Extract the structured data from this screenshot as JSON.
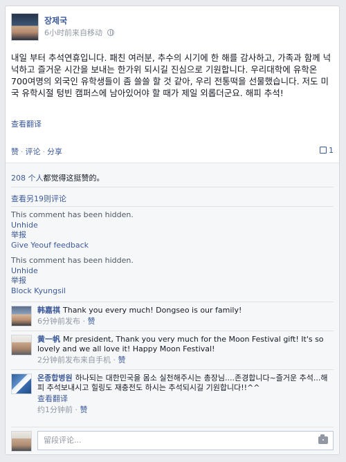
{
  "post": {
    "author": "장제국",
    "meta_time": "6小时前来自移动",
    "text": "내일 부터 추석연휴입니다. 패친 여러분, 추수의 시기에 한 해를 감사하고, 가족과 함께 넉넉하고 즐거운 시간을 보내는 한가위 되시길 진심으로 기원합니다. 우리대학에 유학온 700여명의 외국인 유학생들이 좀 쓸쓸 할 것 같아, 우리 전통떡을 선물했습니다. 저도 미국 유학시절 텅빈 캠퍼스에 남아있어야 할 때가 제일 외롭더군요. 해피 추석!",
    "see_translation": "查看翻译"
  },
  "actions": {
    "like": "赞",
    "comment": "评论",
    "share": "分享",
    "separator": "·",
    "comment_count": "1"
  },
  "ufi": {
    "likes_link": "208 个人",
    "likes_rest": "都觉得这挺赞的。",
    "view_more": "查看另19则评论",
    "hidden1": {
      "text": "This comment has been hidden.",
      "unhide": "Unhide",
      "report": "举报",
      "feedback": "Give Yeouf feedback"
    },
    "hidden2": {
      "text": "This comment has been hidden.",
      "unhide": "Unhide",
      "report": "举报",
      "block": "Block Kyungsil"
    }
  },
  "comments": [
    {
      "name": "韩嘉祺",
      "text": "Thank you every much! Dongseo is our family!",
      "time": "6分钟前发布",
      "like": "赞"
    },
    {
      "name": "黄一帆",
      "text": "Mr president, Thank you very much for the Moon Festival gift! It's so lovely and we all love it! Happy Moon Festival!",
      "time": "2分钟前发布来自手机",
      "like": "赞"
    },
    {
      "name": "온종합병원",
      "text": "하나되는 대한민국을 몸소 실천해주시는 총장님....존경합니다~즐거운 추석...해피 추석보내시고 힐링도 재충전도 하시는 추석되시길 기원합니다!!^^",
      "see_translation": "查看翻译",
      "time": "约1分钟前",
      "like": "赞"
    }
  ],
  "write_comment": {
    "placeholder": "留段评论..."
  },
  "icons": [
    "globe-icon",
    "comment-count-icon",
    "camera-icon"
  ],
  "colors": {
    "link": "#3b5998",
    "meta": "#9197a3",
    "ufi_bg": "#f6f7f8"
  }
}
